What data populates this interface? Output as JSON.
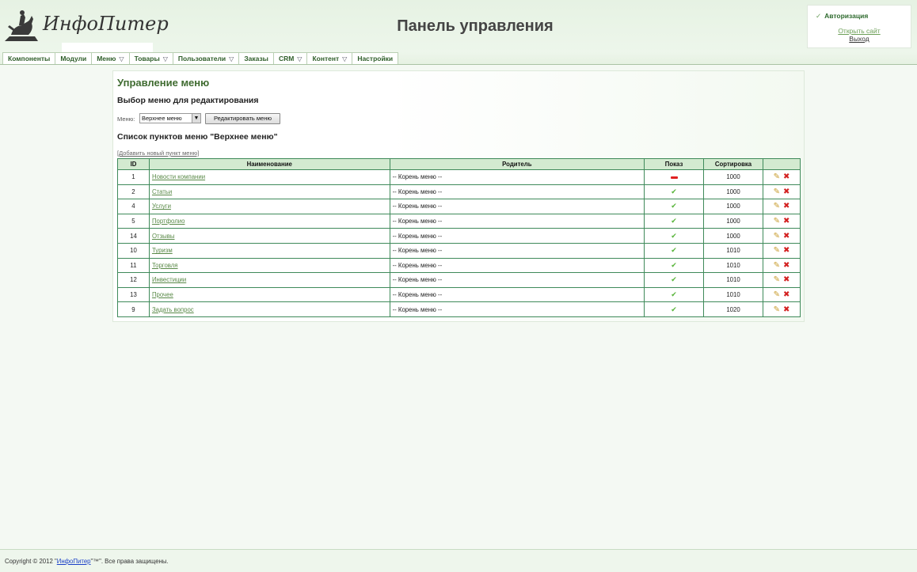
{
  "header": {
    "logo_text": "ИнфоПитер",
    "title": "Панель управления"
  },
  "auth": {
    "title": "Авторизация",
    "open_site": "Открыть сайт",
    "logout": "Выход"
  },
  "nav": {
    "items": [
      {
        "label": "Компоненты",
        "dropdown": false
      },
      {
        "label": "Модули",
        "dropdown": false
      },
      {
        "label": "Меню",
        "dropdown": true
      },
      {
        "label": "Товары",
        "dropdown": true
      },
      {
        "label": "Пользователи",
        "dropdown": true
      },
      {
        "label": "Заказы",
        "dropdown": false
      },
      {
        "label": "CRM",
        "dropdown": true
      },
      {
        "label": "Контент",
        "dropdown": true
      },
      {
        "label": "Настройки",
        "dropdown": false
      }
    ]
  },
  "main": {
    "title": "Управление меню",
    "select_heading": "Выбор меню для редактирования",
    "menu_label": "Меню:",
    "menu_selected": "Верхнее меню",
    "edit_button": "Редактировать меню",
    "list_heading": "Список пунктов меню \"Верхнее меню\"",
    "add_link": "[Добавить новый пункт меню]",
    "columns": [
      "ID",
      "Наименование",
      "Родитель",
      "Показ",
      "Сортировка",
      ""
    ],
    "rows": [
      {
        "id": "1",
        "name": "Новости компании",
        "parent": "-- Корень меню --",
        "show": false,
        "sort": "1000"
      },
      {
        "id": "2",
        "name": "Статьи",
        "parent": "-- Корень меню --",
        "show": true,
        "sort": "1000"
      },
      {
        "id": "4",
        "name": "Услуги",
        "parent": "-- Корень меню --",
        "show": true,
        "sort": "1000"
      },
      {
        "id": "5",
        "name": "Портфолио",
        "parent": "-- Корень меню --",
        "show": true,
        "sort": "1000"
      },
      {
        "id": "14",
        "name": "Отзывы",
        "parent": "-- Корень меню --",
        "show": true,
        "sort": "1000"
      },
      {
        "id": "10",
        "name": "Туризм",
        "parent": "-- Корень меню --",
        "show": true,
        "sort": "1010"
      },
      {
        "id": "11",
        "name": "Торговля",
        "parent": "-- Корень меню --",
        "show": true,
        "sort": "1010"
      },
      {
        "id": "12",
        "name": "Инвестиции",
        "parent": "-- Корень меню --",
        "show": true,
        "sort": "1010"
      },
      {
        "id": "13",
        "name": "Прочее",
        "parent": "-- Корень меню --",
        "show": true,
        "sort": "1010"
      },
      {
        "id": "9",
        "name": "Задать вопрос",
        "parent": "-- Корень меню --",
        "show": true,
        "sort": "1020"
      }
    ]
  },
  "footer": {
    "prefix": "Copyright © 2012 \"",
    "link": "ИнфоПитер",
    "suffix": "\"™\". Все права защищены."
  },
  "icons": {
    "visible": "check-icon",
    "hidden": "minus-icon",
    "edit": "pencil-icon",
    "delete": "delete-icon"
  }
}
